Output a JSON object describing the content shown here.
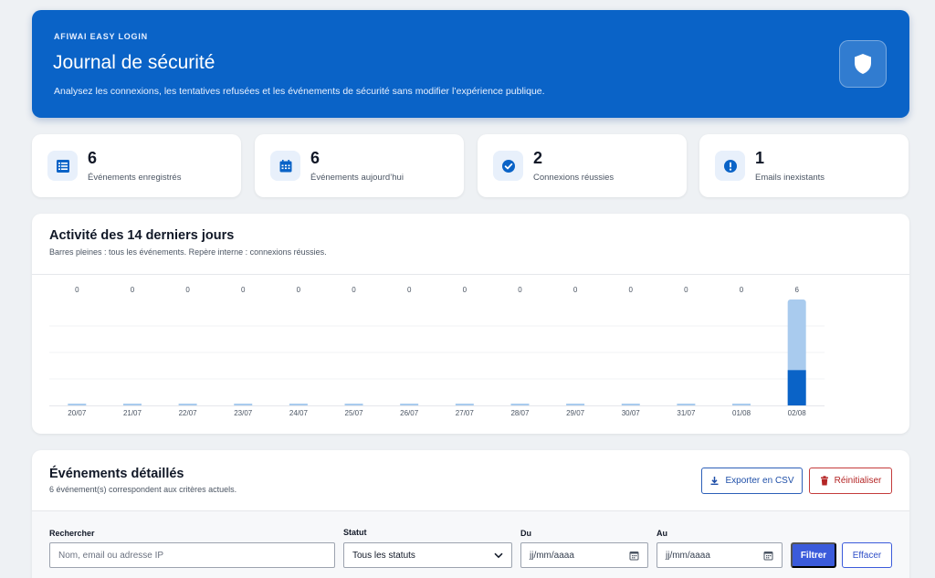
{
  "hero": {
    "kicker": "AFIWAI EASY LOGIN",
    "title": "Journal de sécurité",
    "description": "Analysez les connexions, les tentatives refusées et les événements de sécurité sans modifier l’expérience publique.",
    "icon": "shield-icon"
  },
  "stats": [
    {
      "value": "6",
      "label": "Événements enregistrés",
      "icon": "list-icon"
    },
    {
      "value": "6",
      "label": "Événements aujourd’hui",
      "icon": "calendar-icon"
    },
    {
      "value": "2",
      "label": "Connexions réussies",
      "icon": "check-circle-icon"
    },
    {
      "value": "1",
      "label": "Emails inexistants",
      "icon": "alert-circle-icon"
    }
  ],
  "activity": {
    "title": "Activité des 14 derniers jours",
    "subtitle": "Barres pleines : tous les événements. Repère interne : connexions réussies."
  },
  "chart_data": {
    "type": "bar",
    "categories": [
      "20/07",
      "21/07",
      "22/07",
      "23/07",
      "24/07",
      "25/07",
      "26/07",
      "27/07",
      "28/07",
      "29/07",
      "30/07",
      "31/07",
      "01/08",
      "02/08"
    ],
    "series": [
      {
        "name": "tous les événements",
        "values": [
          0,
          0,
          0,
          0,
          0,
          0,
          0,
          0,
          0,
          0,
          0,
          0,
          0,
          6
        ]
      },
      {
        "name": "connexions réussies",
        "values": [
          0,
          0,
          0,
          0,
          0,
          0,
          0,
          0,
          0,
          0,
          0,
          0,
          0,
          2
        ]
      }
    ],
    "data_labels": [
      "0",
      "0",
      "0",
      "0",
      "0",
      "0",
      "0",
      "0",
      "0",
      "0",
      "0",
      "0",
      "0",
      "6"
    ],
    "ylim": [
      0,
      6
    ],
    "colors": {
      "all": "#a9cbee",
      "success": "#0a63c7"
    },
    "grid": true
  },
  "events": {
    "title": "Événements détaillés",
    "subtitle": "6 événement(s) correspondent aux critères actuels.",
    "export_label": "Exporter en CSV",
    "reset_label": "Réinitialiser"
  },
  "filters": {
    "search_label": "Rechercher",
    "search_placeholder": "Nom, email ou adresse IP",
    "status_label": "Statut",
    "status_value": "Tous les statuts",
    "from_label": "Du",
    "from_value": "jj/mm/aaaa",
    "to_label": "Au",
    "to_value": "jj/mm/aaaa",
    "filter_label": "Filtrer",
    "clear_label": "Effacer"
  },
  "colors": {
    "brand": "#0a63c7",
    "danger": "#b42525",
    "primary_button": "#3b5bdb"
  }
}
